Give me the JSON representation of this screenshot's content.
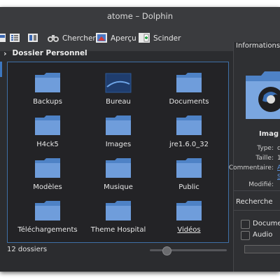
{
  "window": {
    "title": "atome – Dolphin"
  },
  "toolbar": {
    "search_label": "Chercher",
    "preview_label": "Aperçu",
    "split_label": "Scinder"
  },
  "breadcrumb": {
    "location": "Dossier Personnel"
  },
  "folders": [
    {
      "name": "Backups"
    },
    {
      "name": "Bureau"
    },
    {
      "name": "Documents"
    },
    {
      "name": "H4ck5"
    },
    {
      "name": "Images"
    },
    {
      "name": "jre1.6.0_32"
    },
    {
      "name": "Modèles"
    },
    {
      "name": "Musique"
    },
    {
      "name": "Public"
    },
    {
      "name": "Téléchargements"
    },
    {
      "name": "Theme Hospital"
    },
    {
      "name": "Vidéos"
    }
  ],
  "status": {
    "count_label": "12 dossiers",
    "zoom_level": 0.2
  },
  "info_panel": {
    "title": "Informations",
    "name_partial": "Imag",
    "type_label": "Type:",
    "type_value": "d",
    "size_label": "Taille:",
    "size_value": "1",
    "comment_label": "Commentaire:",
    "comment_value": "A",
    "comment_value2": "S",
    "modified_label": "Modifié:"
  },
  "search_panel": {
    "title": "Recherche",
    "options": [
      {
        "label": "Documen"
      },
      {
        "label": "Audio"
      }
    ]
  },
  "colors": {
    "accent": "#3d77c0",
    "folder": "#5b8fd0",
    "background": "#232326"
  }
}
